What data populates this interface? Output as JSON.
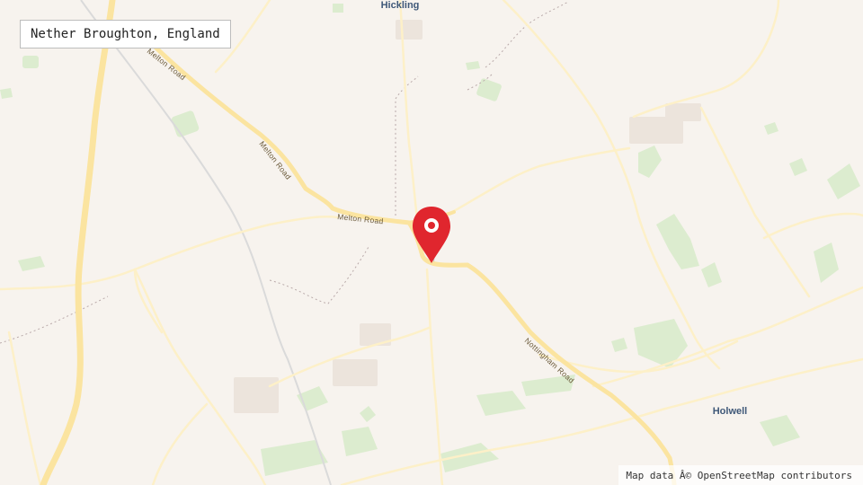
{
  "map": {
    "title": "Nether Broughton, England",
    "attribution": "Map data Â© OpenStreetMap contributors",
    "places": [
      {
        "id": "hickling",
        "label": "Hickling"
      },
      {
        "id": "holwell",
        "label": "Holwell"
      }
    ],
    "road_labels": [
      {
        "id": "melton-road-north-1",
        "label": "Melton Road"
      },
      {
        "id": "melton-road-north-2",
        "label": "Melton Road"
      },
      {
        "id": "melton-road-west",
        "label": "Melton Road"
      },
      {
        "id": "nottingham-road",
        "label": "Nottingham Road"
      }
    ],
    "marker": {
      "label": "location-marker"
    },
    "colors": {
      "background": "#f7f3ee",
      "major_road": "#fbe4a0",
      "minor_road": "#fdf0c8",
      "woodland": "#dceccf",
      "footpath": "#b9a9a9",
      "place_label": "#3f5878",
      "marker": "#e0262e"
    }
  }
}
